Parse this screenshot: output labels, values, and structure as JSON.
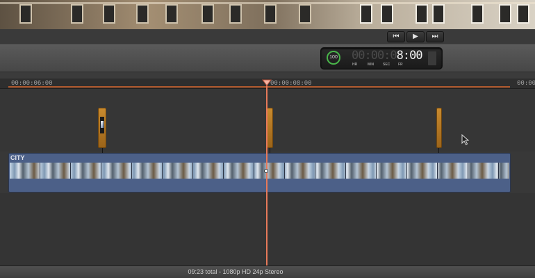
{
  "ruler": {
    "labels": [
      "00:00:06:00",
      "00:00:08:00",
      "00:00"
    ]
  },
  "dashboard": {
    "zoom": "100",
    "timecode_dim": "00:00:0",
    "timecode_lit": "8:00",
    "units": [
      "HR",
      "MIN",
      "SEC",
      "FR"
    ]
  },
  "clip": {
    "name": "CITY"
  },
  "status": {
    "summary": "09:23 total - 1080p HD 24p Stereo"
  },
  "icons": [
    "skip-back-icon",
    "play-icon",
    "skip-forward-icon",
    "playhead-icon",
    "mouse-pointer-icon"
  ],
  "colors": {
    "playhead": "#e7795a",
    "marker": "#c88a2e",
    "clip": "#4c6088",
    "zoom_ring": "#49b54a"
  }
}
